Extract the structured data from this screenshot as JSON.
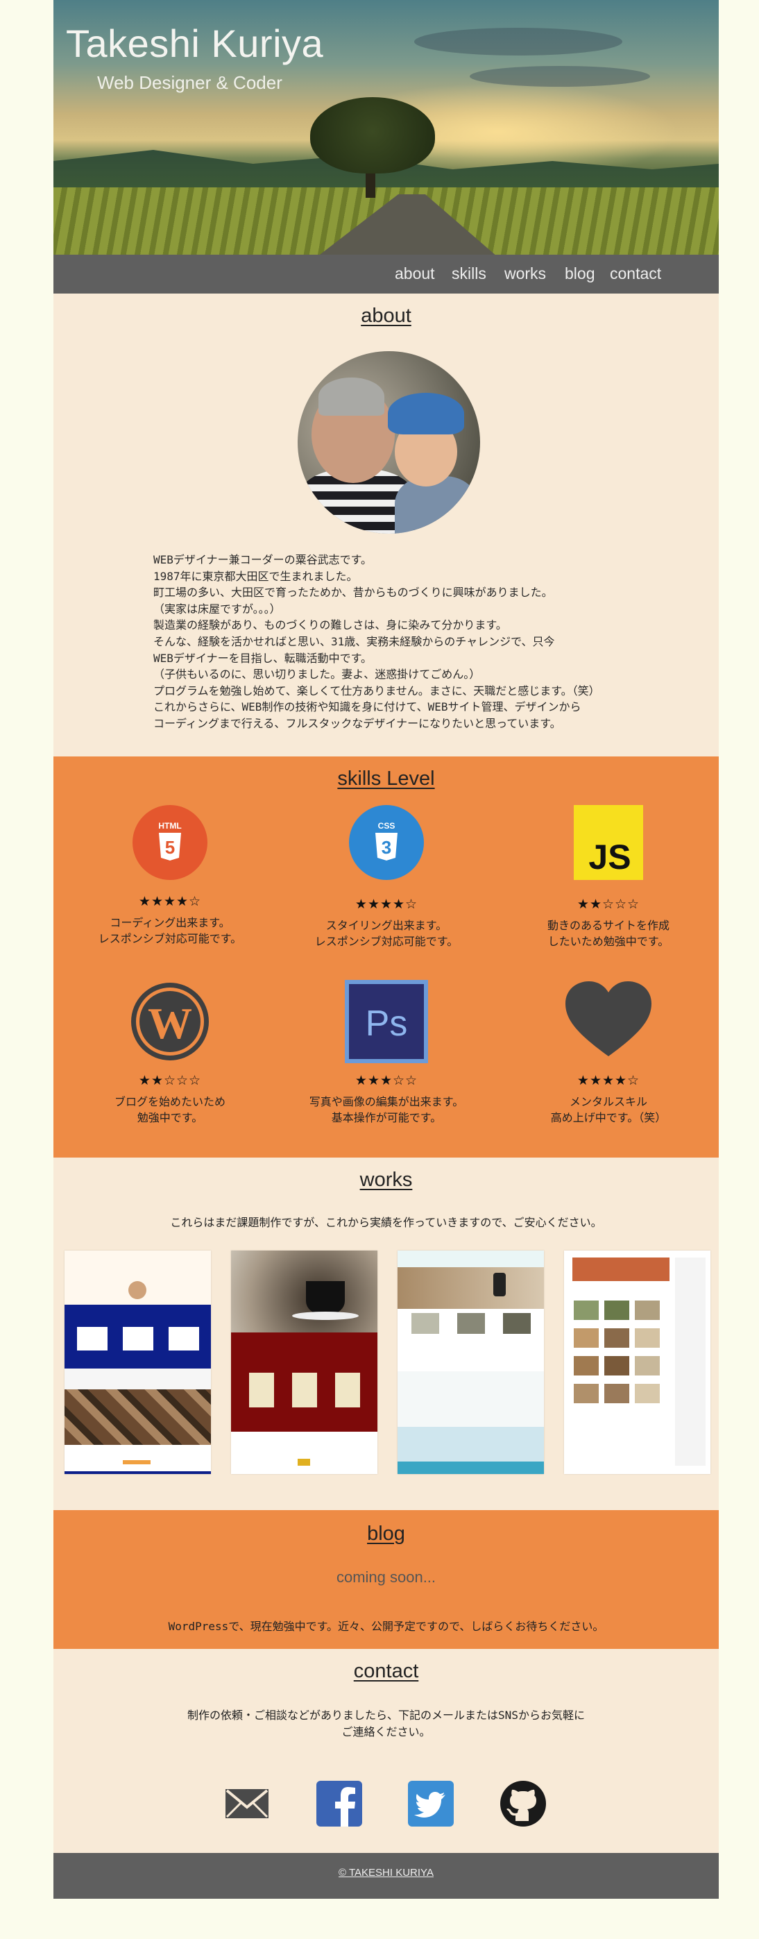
{
  "hero": {
    "name": "Takeshi Kuriya",
    "tagline": "Web Designer & Coder"
  },
  "nav": {
    "items": [
      "about",
      "skills",
      "works",
      "blog",
      "contact"
    ]
  },
  "about": {
    "title": "about",
    "text": "WEBデザイナー兼コーダーの粟谷武志です。\n1987年に東京都大田区で生まれました。\n町工場の多い、大田区で育ったためか、昔からものづくりに興味がありました。\n（実家は床屋ですが。。。）\n製造業の経験があり、ものづくりの難しさは、身に染みて分かります。\nそんな、経験を活かせればと思い、31歳、実務未経験からのチャレンジで、只今\nWEBデザイナーを目指し、転職活動中です。\n（子供もいるのに、思い切りました。妻よ、迷惑掛けてごめん。）\nプログラムを勉強し始めて、楽しくて仕方ありません。まさに、天職だと感じます。（笑）\nこれからさらに、WEB制作の技術や知識を身に付けて、WEBサイト管理、デザインから\nコーディングまで行える、フルスタックなデザイナーになりたいと思っています。"
  },
  "skills": {
    "title": "skills  Level",
    "items": [
      {
        "name": "HTML5",
        "stars": "★★★★☆",
        "desc": "コーディング出来ます。\nレスポンシブ対応可能です。"
      },
      {
        "name": "CSS3",
        "stars": "★★★★☆",
        "desc": "スタイリング出来ます。\nレスポンシブ対応可能です。"
      },
      {
        "name": "JS",
        "stars": "★★☆☆☆",
        "desc": "動きのあるサイトを作成\nしたいため勉強中です。"
      },
      {
        "name": "WordPress",
        "stars": "★★☆☆☆",
        "desc": "ブログを始めたいため\n勉強中です。"
      },
      {
        "name": "Ps",
        "stars": "★★★☆☆",
        "desc": "写真や画像の編集が出来ます。\n基本操作が可能です。"
      },
      {
        "name": "Mental",
        "stars": "★★★★☆",
        "desc": "メンタルスキル\n高め上げ中です。（笑）"
      }
    ],
    "html_label": "HTML",
    "css_label": "CSS",
    "js_label": "JS",
    "ps_label": "Ps"
  },
  "works": {
    "title": "works",
    "lead": "これらはまだ課題制作ですが、これから実績を作っていきますので、ご安心ください。"
  },
  "blog": {
    "title": "blog",
    "soon": "coming soon...",
    "note": "WordPressで、現在勉強中です。近々、公開予定ですので、しばらくお待ちください。"
  },
  "contact": {
    "title": "contact",
    "message": "制作の依頼・ご相談などがありましたら、下記のメールまたはSNSからお気軽に\nご連絡ください。"
  },
  "footer": {
    "copyright": "© TAKESHI KURIYA"
  },
  "colors": {
    "orange": "#ee8b45",
    "cream": "#f8ead7",
    "nav_gray": "#5f5f5f",
    "html_orange": "#e4572e",
    "css_blue": "#2d88d3",
    "js_yellow": "#f7df1e",
    "ps_blue": "#2b2f6e"
  }
}
